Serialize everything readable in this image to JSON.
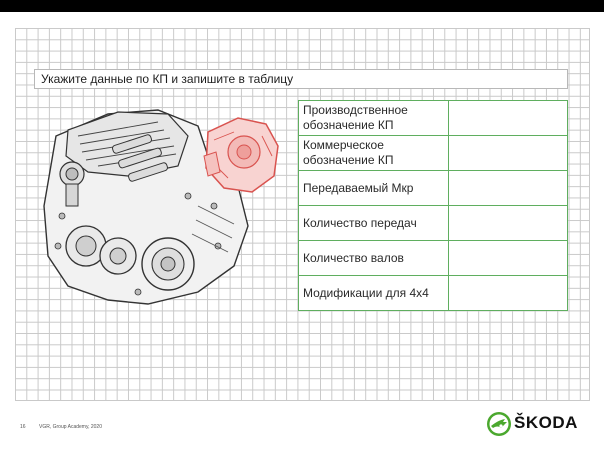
{
  "slide": {
    "title": "Укажите данные по КП и запишите в таблицу",
    "footer": {
      "page_number": "16",
      "text": "VGR, Group Academy, 2020"
    },
    "brand": "ŠKODA"
  },
  "table": {
    "rows": [
      {
        "label": "Производственное обозначение КП",
        "value": ""
      },
      {
        "label": "Коммерческое обозначение КП",
        "value": ""
      },
      {
        "label": "Передаваемый Мкр",
        "value": ""
      },
      {
        "label": "Количество передач",
        "value": ""
      },
      {
        "label": "Количество валов",
        "value": ""
      },
      {
        "label": "Модификации для 4х4",
        "value": ""
      }
    ]
  },
  "colors": {
    "grid": "#c9c9c9",
    "table_border": "#5fae5f",
    "highlight_part": "#d9534f",
    "brand_green": "#4ba82e"
  },
  "icons": {
    "gearbox": "gearbox-illustration",
    "logo": "skoda-arrow-logo"
  }
}
